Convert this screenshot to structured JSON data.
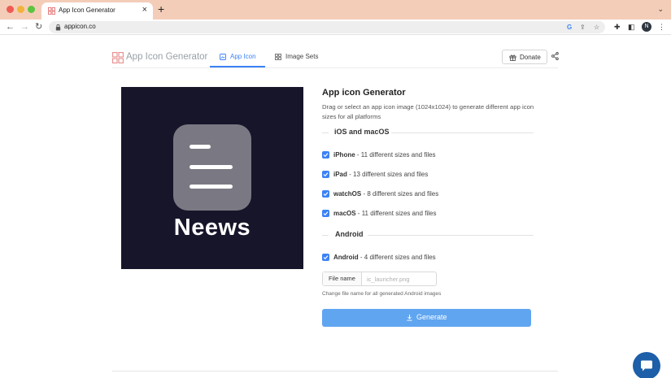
{
  "browser": {
    "tab_title": "App Icon Generator",
    "url": "appicon.co",
    "profile_initial": "N"
  },
  "header": {
    "logo_text": "App Icon Generator",
    "tabs": [
      {
        "label": "App Icon",
        "active": true
      },
      {
        "label": "Image Sets",
        "active": false
      }
    ],
    "donate_label": "Donate"
  },
  "preview": {
    "app_name": "Neews",
    "background": "#16152a",
    "tile_color": "#7a7983"
  },
  "panel": {
    "title": "App icon Generator",
    "description": "Drag or select an app icon image (1024x1024) to generate different app icon sizes for all platforms",
    "sections": [
      {
        "label": "iOS and macOS",
        "options": [
          {
            "name": "iPhone",
            "detail": " - 11 different sizes and files",
            "checked": true
          },
          {
            "name": "iPad",
            "detail": " - 13 different sizes and files",
            "checked": true
          },
          {
            "name": "watchOS",
            "detail": " - 8 different sizes and files",
            "checked": true
          },
          {
            "name": "macOS",
            "detail": " - 11 different sizes and files",
            "checked": true
          }
        ]
      },
      {
        "label": "Android",
        "options": [
          {
            "name": "Android",
            "detail": " - 4 different sizes and files",
            "checked": true
          }
        ]
      }
    ],
    "file_name_label": "File name",
    "file_name_placeholder": "ic_launcher.png",
    "file_name_value": "",
    "file_name_help": "Change file name for all generated Android images",
    "generate_label": "Generate"
  },
  "colors": {
    "accent": "#3b82f6",
    "button": "#60a5f0",
    "chat": "#1d5fa8"
  }
}
